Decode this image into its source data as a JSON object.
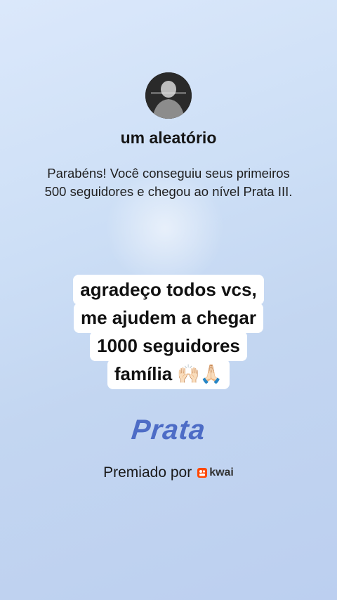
{
  "profile": {
    "username": "um aleatório"
  },
  "achievement": {
    "message": "Parabéns! Você conseguiu seus primeiros 500 seguidores e chegou ao nível Prata III.",
    "level_name": "Prata"
  },
  "caption": {
    "lines": [
      "agradeço todos vcs,",
      "me ajudem a chegar",
      "1000 seguidores",
      "família 🙌🏻🙏🏻"
    ]
  },
  "award": {
    "text": "Premiado por",
    "brand": "kwai"
  },
  "colors": {
    "level_text": "#4d6cc6",
    "brand_mark": "#ff4906"
  }
}
